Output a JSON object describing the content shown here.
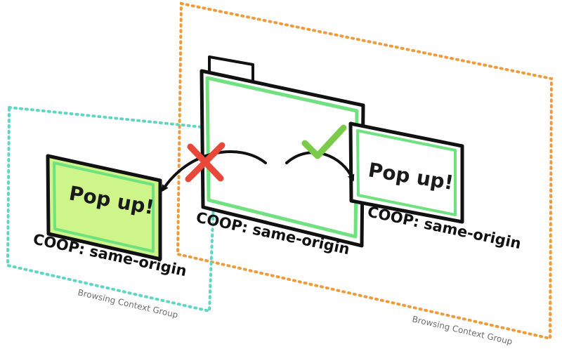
{
  "groups": {
    "left": {
      "label": "Browsing Context Group",
      "color": "#5ed6c3"
    },
    "right": {
      "label": "Browsing Context Group",
      "color": "#ef9b3c"
    }
  },
  "windows": {
    "main": {
      "coop_label": "COOP:  same-origin",
      "border_color": "#6fe27f"
    },
    "popup_left": {
      "text": "Pop up!",
      "coop_label": "COOP:  same-origin",
      "fill_color": "#cdf58a",
      "border_color": "#6fe27f"
    },
    "popup_right": {
      "text": "Pop up!",
      "coop_label": "COOP:  same-origin",
      "border_color": "#6fe27f"
    }
  },
  "connections": {
    "blocked": {
      "icon": "cross-icon",
      "color": "#e8483a"
    },
    "allowed": {
      "icon": "check-icon",
      "color": "#7bcb4a"
    }
  }
}
